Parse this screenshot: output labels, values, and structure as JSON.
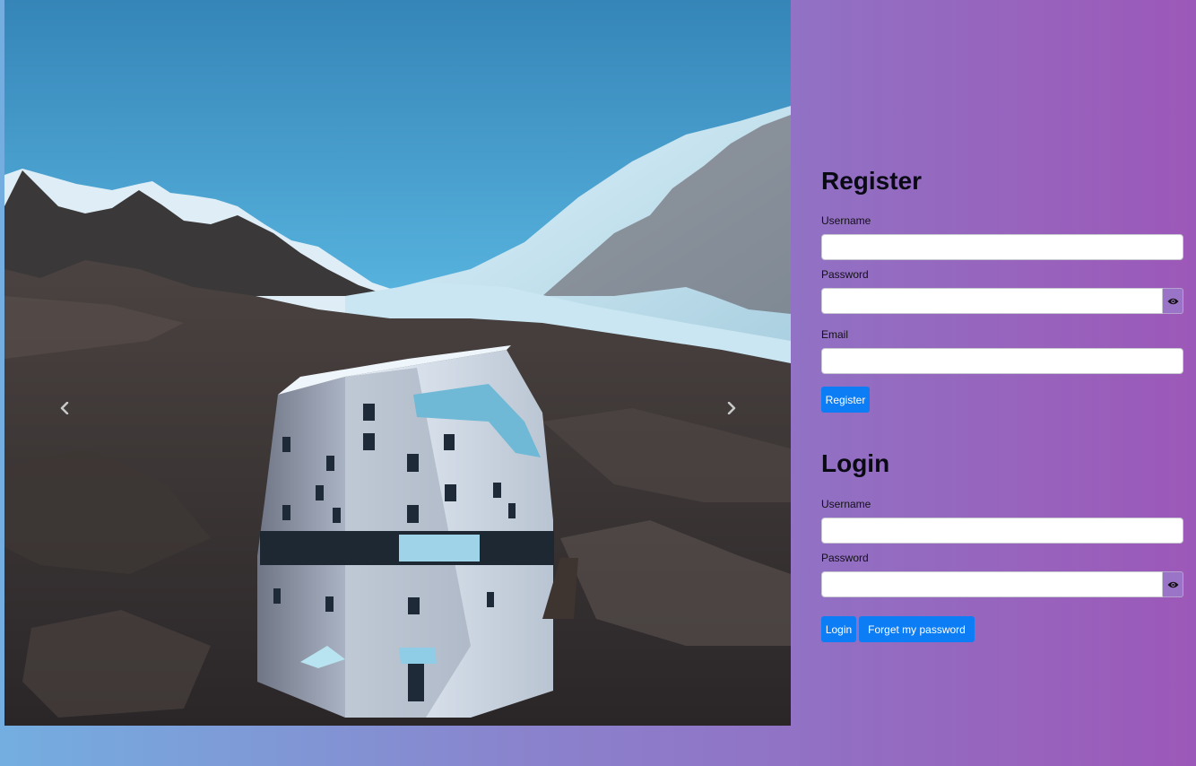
{
  "carousel": {
    "prev_icon": "chevron-left-icon",
    "next_icon": "chevron-right-icon"
  },
  "register": {
    "title": "Register",
    "username_label": "Username",
    "username_value": "",
    "password_label": "Password",
    "password_value": "",
    "password_toggle_icon": "eye-icon",
    "email_label": "Email",
    "email_value": "",
    "submit_label": "Register"
  },
  "login": {
    "title": "Login",
    "username_label": "Username",
    "username_value": "",
    "password_label": "Password",
    "password_value": "",
    "password_toggle_icon": "eye-icon",
    "submit_label": "Login",
    "forgot_label": "Forget my password"
  },
  "colors": {
    "button": "#0d7df5",
    "background_start": "#74aee0",
    "background_end": "#9c58b8"
  }
}
